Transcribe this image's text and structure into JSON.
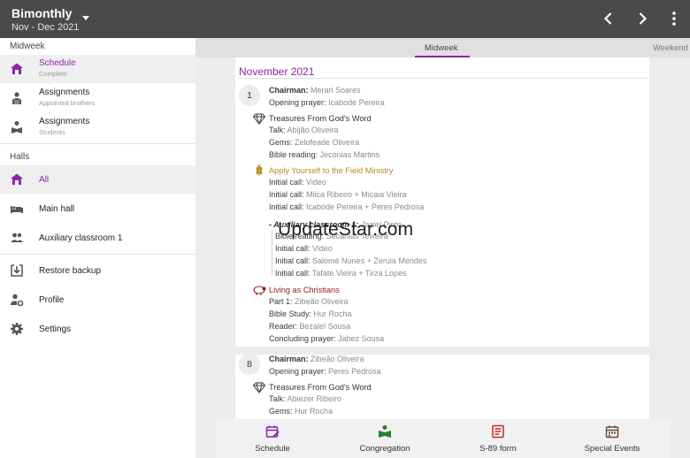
{
  "app": {
    "title": "Bimonthly",
    "period": "Nov - Dec 2021"
  },
  "colors": {
    "topbar": "#4a4a4a",
    "accent": "#8e24aa",
    "gold": "#b58a22",
    "red": "#9b1b22",
    "green": "#2e7d32"
  },
  "sidebar": {
    "section_midweek": "Midweek",
    "items_midweek": [
      {
        "label": "Schedule",
        "sub": "Complete",
        "icon": "home-icon"
      },
      {
        "label": "Assignments",
        "sub": "Appointed brothers",
        "icon": "person-podium-icon"
      },
      {
        "label": "Assignments",
        "sub": "Students",
        "icon": "person-book-icon"
      }
    ],
    "section_halls": "Halls",
    "items_halls": [
      {
        "label": "All",
        "icon": "home-icon"
      },
      {
        "label": "Main hall",
        "icon": "bed-icon"
      },
      {
        "label": "Auxiliary classroom 1",
        "icon": "group-icon"
      }
    ],
    "items_other": [
      {
        "label": "Restore backup",
        "icon": "download-icon"
      },
      {
        "label": "Profile",
        "icon": "person-gear-icon"
      },
      {
        "label": "Settings",
        "icon": "gear-icon"
      }
    ]
  },
  "tabs": {
    "midweek": "Midweek",
    "weekend": "Weekend"
  },
  "schedule": {
    "month": "November 2021",
    "week1": {
      "day": "1",
      "chairman_label": "Chairman:",
      "chairman": "Merari Soares",
      "opening_label": "Opening prayer:",
      "opening": "Icabode Pereira",
      "treasures_title": "Treasures From God's Word",
      "talk_label": "Talk:",
      "talk": "Abijão Oliveira",
      "gems_label": "Gems:",
      "gems": "Zelofeade Oliveira",
      "bible_label": "Bible reading:",
      "bible": "Jeconias Martins",
      "ministry_title": "Apply Yourself to the Field Ministry",
      "call1_label": "Initial call:",
      "call1": "Video",
      "call2_label": "Initial call:",
      "call2": "Milca Ribeiro + Micaia Vieira",
      "call3_label": "Initial call:",
      "call3": "Icabode Pereira + Peres Pedrosa",
      "aux_label": "- Auxiliary classroom 1:",
      "aux": "Jaziel Pinto",
      "aux_bible_label": "Bible reading:",
      "aux_bible": "Secanias Teixeira",
      "aux_call1_label": "Initial call:",
      "aux_call1": "Video",
      "aux_call2_label": "Initial call:",
      "aux_call2": "Salomé Nunes + Zeruia Mendes",
      "aux_call3_label": "Initial call:",
      "aux_call3": "Tafate Vieira + Tirza Lopes",
      "living_title": "Living as Christians",
      "part1_label": "Part 1:",
      "part1": "Zibeão Oliveira",
      "study_label": "Bible Study:",
      "study": "Hur Rocha",
      "reader_label": "Reader:",
      "reader": "Bezalel Sousa",
      "closing_label": "Concluding prayer:",
      "closing": "Jabez Sousa"
    },
    "week2": {
      "day": "8",
      "chairman_label": "Chairman:",
      "chairman": "Zibeão Oliveira",
      "opening_label": "Opening prayer:",
      "opening": "Peres Pedrosa",
      "treasures_title": "Treasures From God's Word",
      "talk_label": "Talk:",
      "talk": "Abiezer Ribeiro",
      "gems_label": "Gems:",
      "gems": "Hur Rocha"
    }
  },
  "watermark": "UpdateStar.com",
  "bottom_nav": [
    {
      "label": "Schedule",
      "icon": "calendar-edit-icon"
    },
    {
      "label": "Congregation",
      "icon": "open-book-icon"
    },
    {
      "label": "S-89 form",
      "icon": "form-icon"
    },
    {
      "label": "Special Events",
      "icon": "calendar-icon"
    }
  ]
}
